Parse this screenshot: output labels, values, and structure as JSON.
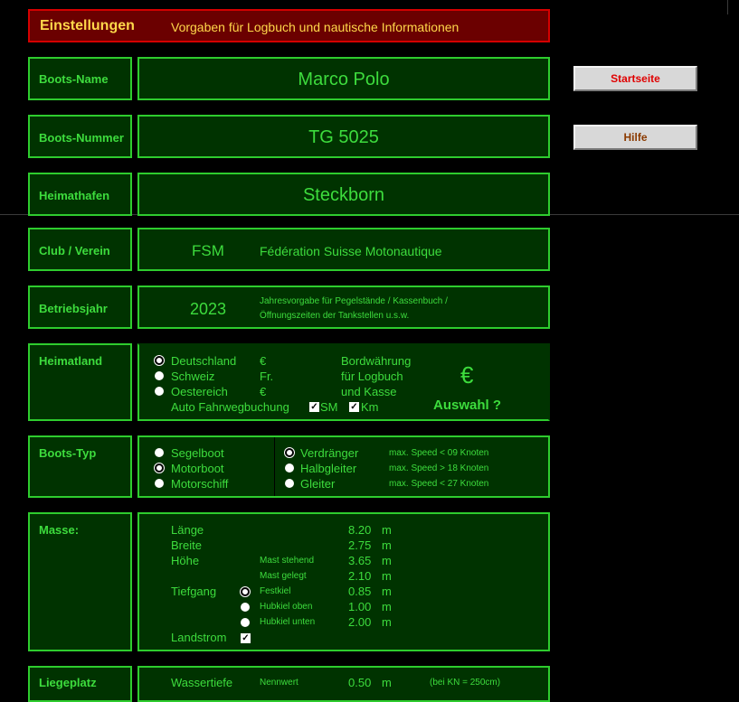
{
  "header": {
    "title": "Einstellungen",
    "subtitle": "Vorgaben für Logbuch und nautische Informationen"
  },
  "buttons": {
    "startseite": "Startseite",
    "hilfe": "Hilfe"
  },
  "boat_name": {
    "label": "Boots-Name",
    "value": "Marco Polo"
  },
  "boat_number": {
    "label": "Boots-Nummer",
    "value": "TG 5025"
  },
  "home_port": {
    "label": "Heimathafen",
    "value": "Steckborn"
  },
  "club": {
    "label": "Club / Verein",
    "short": "FSM",
    "full": "Fédération Suisse Motonautique"
  },
  "year": {
    "label": "Betriebsjahr",
    "value": "2023",
    "note1": "Jahresvorgabe für Pegelstände / Kassenbuch /",
    "note2": "Öffnungszeiten der Tankstellen u.s.w."
  },
  "country": {
    "label": "Heimatland",
    "options": [
      {
        "name": "Deutschland",
        "currency": "€",
        "selected": true
      },
      {
        "name": "Schweiz",
        "currency": "Fr.",
        "selected": false
      },
      {
        "name": "Oestereich",
        "currency": "€",
        "selected": false
      }
    ],
    "currency_text": [
      "Bordwährung",
      "für Logbuch",
      "und Kasse"
    ],
    "currency_symbol": "€",
    "auswahl": "Auswahl ?",
    "auto_label": "Auto Fahrwegbuchung",
    "sm_label": "SM",
    "km_label": "Km"
  },
  "boat_type": {
    "label": "Boots-Typ",
    "types": [
      {
        "name": "Segelboot",
        "selected": false
      },
      {
        "name": "Motorboot",
        "selected": true
      },
      {
        "name": "Motorschiff",
        "selected": false
      }
    ],
    "hulls": [
      {
        "name": "Verdränger",
        "speed": "max. Speed < 09 Knoten",
        "selected": true
      },
      {
        "name": "Halbgleiter",
        "speed": "max. Speed > 18 Knoten",
        "selected": false
      },
      {
        "name": "Gleiter",
        "speed": "max. Speed < 27 Knoten",
        "selected": false
      }
    ]
  },
  "masse": {
    "label": "Masse:",
    "laenge": "Länge",
    "laenge_val": "8.20",
    "breite": "Breite",
    "breite_val": "2.75",
    "hoehe": "Höhe",
    "mast_stehend": "Mast stehend",
    "mast_stehend_val": "3.65",
    "mast_gelegt": "Mast gelegt",
    "mast_gelegt_val": "2.10",
    "tiefgang": "Tiefgang",
    "festkiel": "Festkiel",
    "festkiel_val": "0.85",
    "hubkiel_oben": "Hubkiel oben",
    "hubkiel_oben_val": "1.00",
    "hubkiel_unten": "Hubkiel unten",
    "hubkiel_unten_val": "2.00",
    "unit": "m",
    "landstrom": "Landstrom"
  },
  "liegeplatz": {
    "label": "Liegeplatz",
    "wassertiefe": "Wassertiefe",
    "nennwert": "Nennwert",
    "value": "0.50",
    "unit": "m",
    "note": "(bei KN = 250cm)"
  },
  "colors": {
    "accent": "#3ddc3d",
    "panel": "#003300",
    "header": "#6b0000",
    "btn_red": "#e00000",
    "btn_brown": "#8b3a00"
  }
}
